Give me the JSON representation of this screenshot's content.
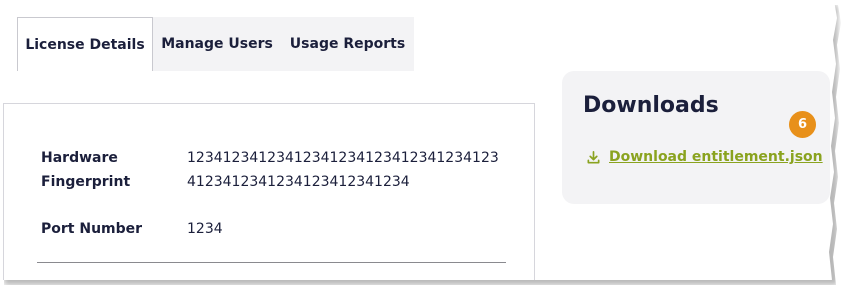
{
  "tabs": [
    {
      "label": "License Details",
      "active": true
    },
    {
      "label": "Manage Users",
      "active": false
    },
    {
      "label": "Usage Reports",
      "active": false
    }
  ],
  "details": {
    "fingerprint_label": "Hardware Fingerprint",
    "fingerprint_value": "123412341234123412341234123412341234123412341234123412341234",
    "port_label": "Port Number",
    "port_value": "1234"
  },
  "downloads": {
    "title": "Downloads",
    "badge": "6",
    "link_label": "Download entitlement.json",
    "icon": "download-icon"
  },
  "colors": {
    "accent_link": "#8aa31f",
    "badge": "#e8901a",
    "text": "#1b1f3b",
    "panel_bg": "#f3f3f5"
  }
}
